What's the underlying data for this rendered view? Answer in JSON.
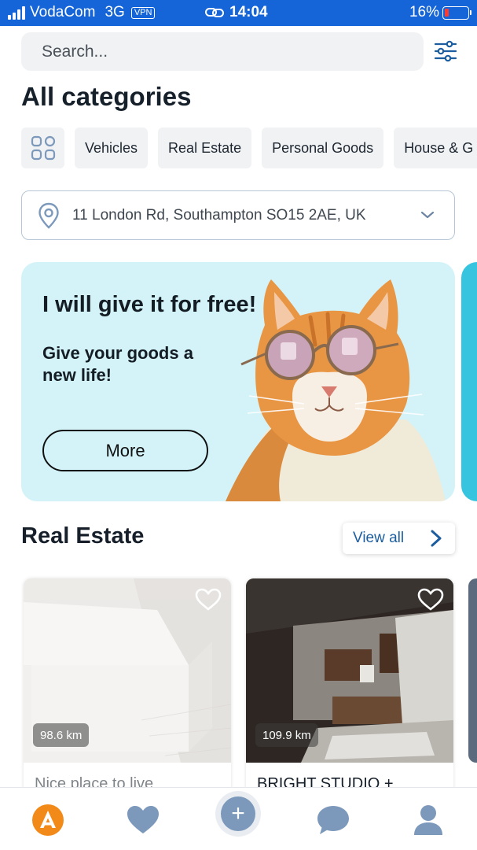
{
  "status_bar": {
    "carrier": "VodaCom",
    "network": "3G",
    "vpn": "VPN",
    "time": "14:04",
    "battery": "16%"
  },
  "search": {
    "placeholder": "Search..."
  },
  "title": "All categories",
  "categories": [
    "Vehicles",
    "Real Estate",
    "Personal Goods",
    "House & G"
  ],
  "location": {
    "address": "11 London Rd, Southampton SO15 2AE, UK"
  },
  "banner": {
    "title": "I will give it for free!",
    "subtitle": "Give your goods a new life!",
    "button": "More"
  },
  "section": {
    "title": "Real Estate",
    "view_all": "View all"
  },
  "listings": [
    {
      "title": "Nice place to live",
      "distance": "98.6 km"
    },
    {
      "title": "BRIGHT STUDIO +",
      "distance": "109.9 km"
    }
  ],
  "colors": {
    "status_bar": "#1565d8",
    "brand_orange": "#f28a1a",
    "tab_icon": "#7c99bb",
    "banner_bg": "#d3f3f9",
    "link_blue": "#1b5d9e"
  },
  "tab_bar": {
    "items": [
      "home-logo-icon",
      "heart-icon",
      "add-icon",
      "chat-icon",
      "profile-icon"
    ]
  }
}
